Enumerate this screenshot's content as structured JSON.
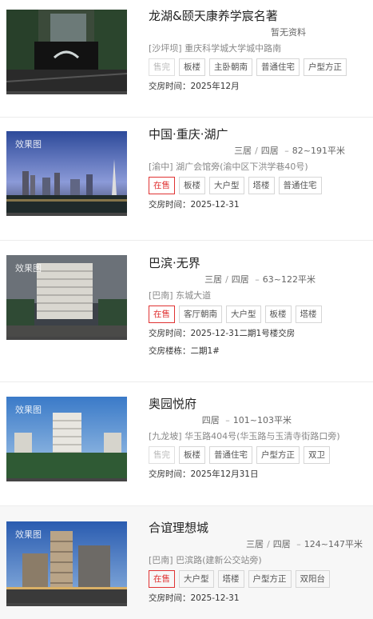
{
  "listings": [
    {
      "title": "龙湖&颐天康养学宸名著",
      "meta": "暂无资料",
      "address": "[沙坪坝] 重庆科学城大学城中路南",
      "status": "售完",
      "tags": [
        "板楼",
        "主卧朝南",
        "普通住宅",
        "户型方正"
      ],
      "delivery_label": "交房时间：",
      "delivery": "2025年12月",
      "watermark": ""
    },
    {
      "title": "中国·重庆·湖广",
      "rooms_a": "三居",
      "rooms_b": "四居",
      "area": "82~191平米",
      "address": "[渝中] 湖广会馆旁(渝中区下洪学巷40号)",
      "status": "在售",
      "tags": [
        "板楼",
        "大户型",
        "塔楼",
        "普通住宅"
      ],
      "delivery_label": "交房时间：",
      "delivery": "2025-12-31",
      "watermark": "效果图"
    },
    {
      "title": "巴滨·无界",
      "rooms_a": "三居",
      "rooms_b": "四居",
      "area": "63~122平米",
      "address": "[巴南] 东城大道",
      "status": "在售",
      "tags": [
        "客厅朝南",
        "大户型",
        "板楼",
        "塔楼"
      ],
      "delivery_label": "交房时间：",
      "delivery": "2025-12-31二期1号楼交房",
      "building_label": "交房楼栋：",
      "building": "二期1#",
      "watermark": "效果图"
    },
    {
      "title": "奥园悦府",
      "rooms_a": "四居",
      "area": "101~103平米",
      "address": "[九龙坡] 华玉路404号(华玉路与玉清寺街路口旁)",
      "status": "售完",
      "tags": [
        "板楼",
        "普通住宅",
        "户型方正",
        "双卫"
      ],
      "delivery_label": "交房时间：",
      "delivery": "2025年12月31日",
      "watermark": "效果图"
    },
    {
      "title": "合谊理想城",
      "rooms_a": "三居",
      "rooms_b": "四居",
      "area": "124~147平米",
      "address": "[巴南] 巴滨路(建新公交站旁)",
      "status": "在售",
      "tags": [
        "大户型",
        "塔楼",
        "户型方正",
        "双阳台"
      ],
      "delivery_label": "交房时间：",
      "delivery": "2025-12-31",
      "watermark": "效果图"
    }
  ],
  "ui": {
    "meta_separator": "/",
    "area_dash": "–"
  },
  "colors": {
    "on_sale": "#e03333",
    "sold_out": "#bbbbbb"
  }
}
